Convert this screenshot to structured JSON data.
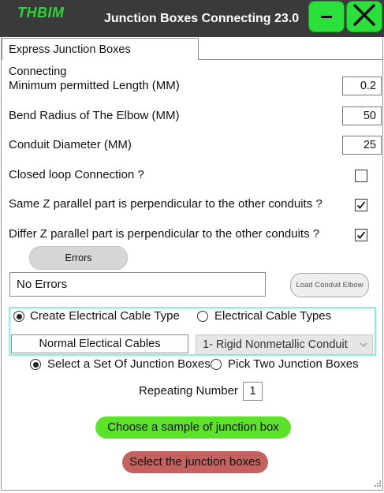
{
  "window": {
    "logo": "THBIM",
    "title": "Junction Boxes Connecting 23.0",
    "minimize_symbol": "−",
    "close_icon": "x-icon"
  },
  "tabs": [
    {
      "label": "Express Junction Boxes Connecting",
      "selected": true
    }
  ],
  "settings": {
    "min_length": {
      "label": "Minimum permitted Length (MM)",
      "value": "0.2"
    },
    "bend_radius": {
      "label": "Bend Radius of The Elbow (MM)",
      "value": "50"
    },
    "conduit_diameter": {
      "label": "Conduit Diameter (MM)",
      "value": "25"
    },
    "closed_loop": {
      "label": "Closed loop Connection ?",
      "checked": false
    },
    "same_z": {
      "label": "Same Z parallel part is perpendicular to the other conduits ?",
      "checked": true
    },
    "differ_z": {
      "label": "Differ Z parallel part is perpendicular to the other conduits ?",
      "checked": true
    }
  },
  "errors": {
    "button_label": "Errors",
    "field_value": "No Errors"
  },
  "load_elbow_label": "Load Conduit Elbow",
  "cable": {
    "create_type_label": "Create Electrical Cable Type",
    "create_type_selected": true,
    "types_label": "Electrical Cable Types",
    "types_selected": false,
    "name_value": "Normal Electical Cables",
    "type_selected_value": "1- Rigid Nonmetallic Conduit"
  },
  "selection": {
    "set_label": "Select a Set Of Junction Boxes",
    "set_selected": true,
    "pick_two_label": "Pick Two Junction Boxes",
    "pick_two_selected": false
  },
  "repeating": {
    "label": "Repeating Number",
    "value": "1"
  },
  "actions": {
    "sample_label": "Choose a sample of junction box",
    "select_label": "Select the junction boxes"
  },
  "colors": {
    "titlebar": "#3a3a3a",
    "accent_green": "#2be03a",
    "sample_button": "#5de22c",
    "select_button": "#c4625f",
    "group_border": "#86f0d8"
  }
}
